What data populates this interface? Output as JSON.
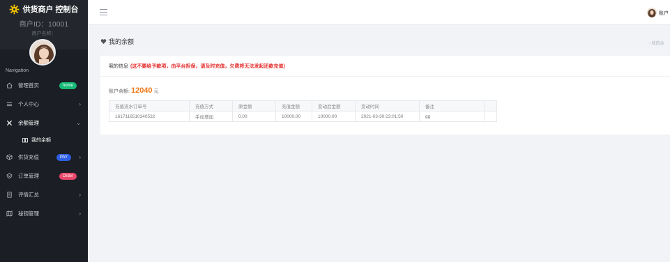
{
  "brand": {
    "title": "供货商户 控制台",
    "merchant_id": "商户ID：10001",
    "merchant_name": "商户名称："
  },
  "nav": {
    "heading": "Navigation",
    "items": [
      {
        "label": "管理首页",
        "badge": "home",
        "badge_color": "#17b978"
      },
      {
        "label": "个人中心",
        "chevron": "›"
      },
      {
        "label": "余额管理",
        "chevron": "⌄"
      },
      {
        "label": "我的余额",
        "sub": true
      },
      {
        "label": "供货充值",
        "badge": "PAY",
        "badge_color": "#2f5fe3",
        "chevron": "›"
      },
      {
        "label": "订单管理",
        "badge": "Order",
        "badge_color": "#e8486a"
      },
      {
        "label": "评情汇总",
        "chevron": "›"
      },
      {
        "label": "秘钥管理",
        "chevron": "›"
      }
    ]
  },
  "topbar": {
    "user": "账户"
  },
  "page": {
    "title": "我的余额",
    "breadcrumb": "› 我的余"
  },
  "card": {
    "head_title": "我的信息",
    "warning": "(这不要给予款项，由平台担保，请及时充值，欠费将无法发起还款充值)",
    "balance_label": "账户余额:",
    "balance_value": "12040",
    "balance_unit": "元",
    "columns": [
      "充值流水订单号",
      "充值方式",
      "原金额",
      "充值金额",
      "变动后金额",
      "变动时间",
      "备注",
      ""
    ],
    "rows": [
      [
        "1617116510340532",
        "手动增加",
        "0.00",
        "10000.00",
        "10000.00",
        "2021-03-30 23:01:50",
        "gg",
        ""
      ]
    ]
  },
  "colors": {
    "sidebar_bg": "#1b1e24",
    "accent_orange": "#f07a1a",
    "warning_red": "#e52d2d"
  }
}
